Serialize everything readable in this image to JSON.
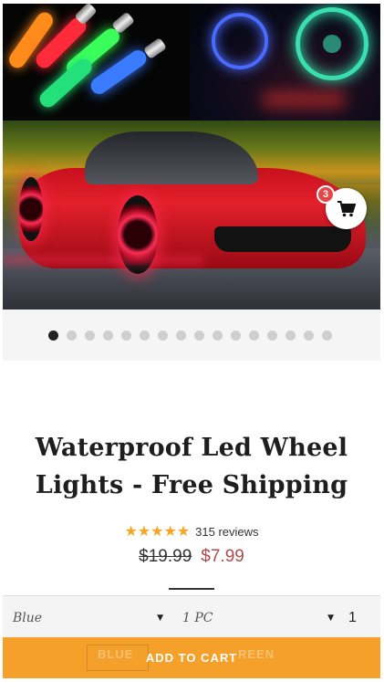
{
  "gallery": {
    "cart_badge_count": "3",
    "slide_count": 16,
    "active_slide": 0
  },
  "product": {
    "title": "Waterproof Led Wheel Lights - Free Shipping",
    "rating": 5,
    "reviews_label": "315 reviews",
    "compare_price": "$19.99",
    "price": "$7.99"
  },
  "variants": {
    "color_value": "Blue",
    "pack_value": "1 PC",
    "quantity": "1"
  },
  "cart_bar": {
    "add_to_cart_label": "ADD TO CART",
    "ghost_left": "BLUE",
    "ghost_right": "REEN"
  },
  "colors": {
    "accent": "#f4a02a",
    "sale": "#b04a4a",
    "star": "#f5a623",
    "badge": "#e64545"
  }
}
